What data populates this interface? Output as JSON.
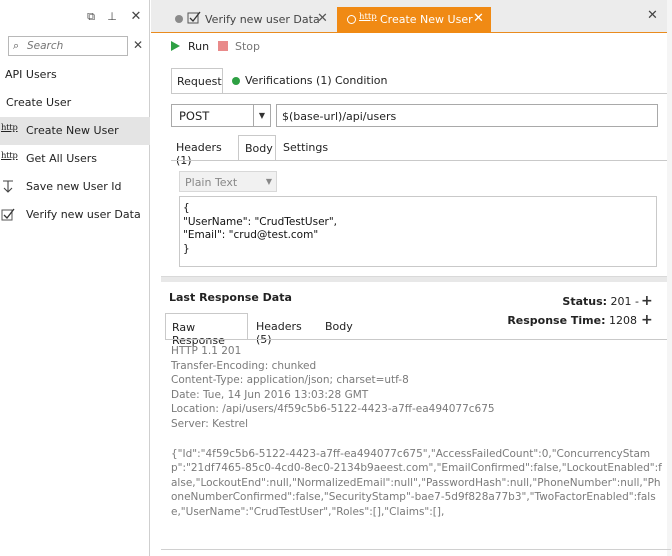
{
  "left_panel": {
    "search_placeholder": "Search",
    "items": [
      {
        "label": "API Users",
        "icon": "none"
      },
      {
        "label": "Create User",
        "icon": "none"
      },
      {
        "label": "Create New User",
        "icon": "http-icon",
        "selected": true
      },
      {
        "label": "Get All Users",
        "icon": "http-icon"
      },
      {
        "label": "Save new User Id",
        "icon": "arrow-down-icon"
      },
      {
        "label": "Verify new user Data",
        "icon": "checkbox-icon"
      }
    ],
    "http_glyph": "http"
  },
  "tabs": [
    {
      "label": "Verify new user Data",
      "active": false
    },
    {
      "label": "Create New User",
      "active": true
    }
  ],
  "toolbar": {
    "run_label": "Run",
    "stop_label": "Stop"
  },
  "request_tabs": {
    "request": "Request",
    "verifications": "Verifications (1)",
    "condition": "Condition"
  },
  "method": "POST",
  "url": "$(base-url)/api/users",
  "body_tabs": {
    "headers": "Headers (1)",
    "body": "Body",
    "settings": "Settings"
  },
  "body_format": "Plain Text",
  "body_text": "{\n\"UserName\": \"CrudTestUser\",\n\"Email\": \"crud@test.com\"\n}",
  "response": {
    "title": "Last Response Data",
    "status_label": "Status:",
    "status_value": "201 -",
    "time_label": "Response Time:",
    "time_value": "1208",
    "tabs": {
      "raw": "Raw Response",
      "headers": "Headers (5)",
      "body": "Body"
    },
    "lines": [
      "HTTP 1.1 201",
      "Transfer-Encoding: chunked",
      "Content-Type: application/json; charset=utf-8",
      "Date: Tue, 14 Jun 2016 13:03:28 GMT",
      "Location: /api/users/4f59c5b6-5122-4423-a7ff-ea494077c675",
      "Server: Kestrel"
    ],
    "json": "{\"Id\":\"4f59c5b6-5122-4423-a7ff-ea494077c675\",\"AccessFailedCount\":0,\"ConcurrencyStamp\":\"21df7465-85c0-4cd0-8ec0-2134b9aeest.com\",\"EmailConfirmed\":false,\"LockoutEnabled\":false,\"LockoutEnd\":null,\"NormalizedEmail\":null\",\"PasswordHash\":null,\"PhoneNumber\":null,\"PhoneNumberConfirmed\":false,\"SecurityStamp\"-bae7-5d9f828a77b3\",\"TwoFactorEnabled\":false,\"UserName\":\"CrudTestUser\",\"Roles\":[],\"Claims\":[],"
  },
  "colors": {
    "accent": "#f08a14",
    "run": "#2ea043",
    "stop": "#e98a8a",
    "selected_row": "#e4e4e4"
  }
}
